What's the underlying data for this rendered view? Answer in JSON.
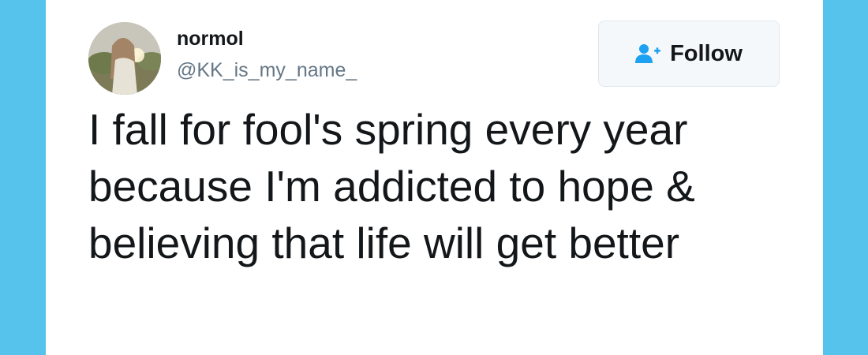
{
  "tweet": {
    "author": {
      "display_name": "normol",
      "handle": "@KK_is_my_name_",
      "avatar_icon": "profile-photo"
    },
    "follow_button": {
      "label": "Follow",
      "icon": "add-user-icon"
    },
    "text": "I fall for fool's spring every year because I'm addicted to hope & believing that life will get better"
  },
  "colors": {
    "background": "#55c3ec",
    "card": "#ffffff",
    "text": "#14171a",
    "secondary_text": "#657786",
    "accent": "#1da1f2"
  }
}
